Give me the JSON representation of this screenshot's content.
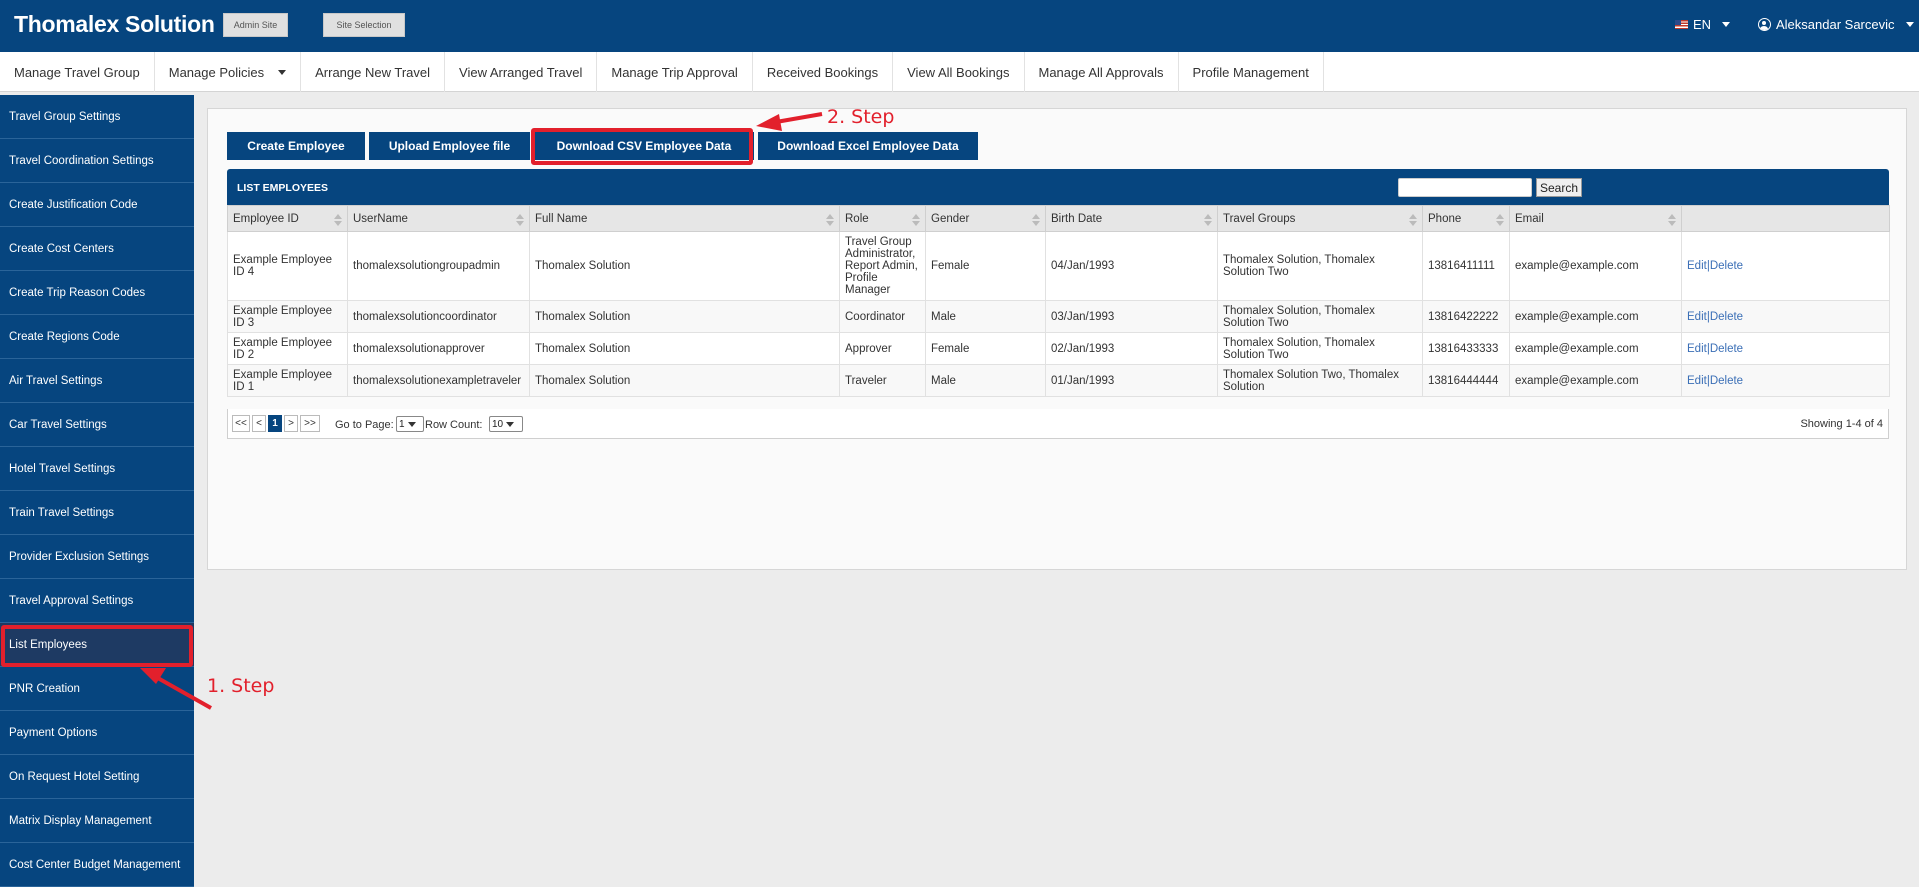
{
  "header": {
    "brand": "Thomalex Solution",
    "admin_site": "Admin Site",
    "site_selection": "Site Selection",
    "language": "EN",
    "user_name": "Aleksandar Sarcevic"
  },
  "topnav": [
    "Manage Travel Group",
    "Manage Policies",
    "Arrange New Travel",
    "View Arranged Travel",
    "Manage Trip Approval",
    "Received Bookings",
    "View All Bookings",
    "Manage All Approvals",
    "Profile Management"
  ],
  "sidebar": [
    "Travel Group Settings",
    "Travel Coordination Settings",
    "Create Justification Code",
    "Create Cost Centers",
    "Create Trip Reason Codes",
    "Create Regions Code",
    "Air Travel Settings",
    "Car Travel Settings",
    "Hotel Travel Settings",
    "Train Travel Settings",
    "Provider Exclusion Settings",
    "Travel Approval Settings",
    "List Employees",
    "PNR Creation",
    "Payment Options",
    "On Request Hotel Setting",
    "Matrix Display Management",
    "Cost Center Budget Management"
  ],
  "actions": {
    "create": "Create Employee",
    "upload": "Upload Employee file",
    "download_csv": "Download CSV Employee Data",
    "download_excel": "Download Excel Employee Data"
  },
  "list": {
    "title": "LIST EMPLOYEES",
    "search_button": "Search",
    "search_value": "",
    "columns": [
      "Employee ID",
      "UserName",
      "Full Name",
      "Role",
      "Gender",
      "Birth Date",
      "Travel Groups",
      "Phone",
      "Email"
    ],
    "rows": [
      {
        "id": "Example Employee ID 4",
        "username": "thomalexsolutiongroupadmin",
        "full_name": "Thomalex Solution",
        "role": "Travel Group Administrator, Report Admin, Profile Manager",
        "gender": "Female",
        "birth": "04/Jan/1993",
        "groups": "Thomalex Solution, Thomalex Solution Two",
        "phone": "13816411111",
        "email": "example@example.com",
        "edit": "Edit",
        "sep": "|",
        "delete": "Delete"
      },
      {
        "id": "Example Employee ID 3",
        "username": "thomalexsolutioncoordinator",
        "full_name": "Thomalex Solution",
        "role": "Coordinator",
        "gender": "Male",
        "birth": "03/Jan/1993",
        "groups": "Thomalex Solution, Thomalex Solution Two",
        "phone": "13816422222",
        "email": "example@example.com",
        "edit": "Edit",
        "sep": "|",
        "delete": "Delete"
      },
      {
        "id": "Example Employee ID 2",
        "username": "thomalexsolutionapprover",
        "full_name": "Thomalex Solution",
        "role": "Approver",
        "gender": "Female",
        "birth": "02/Jan/1993",
        "groups": "Thomalex Solution, Thomalex Solution Two",
        "phone": "13816433333",
        "email": "example@example.com",
        "edit": "Edit",
        "sep": "|",
        "delete": "Delete"
      },
      {
        "id": "Example Employee ID 1",
        "username": "thomalexsolutionexampletraveler",
        "full_name": "Thomalex Solution",
        "role": "Traveler",
        "gender": "Male",
        "birth": "01/Jan/1993",
        "groups": "Thomalex Solution Two, Thomalex Solution",
        "phone": "13816444444",
        "email": "example@example.com",
        "edit": "Edit",
        "sep": "|",
        "delete": "Delete"
      }
    ]
  },
  "pager": {
    "first": "<<",
    "prev": "<",
    "current": "1",
    "next": ">",
    "last": ">>",
    "goto_label": "Go to Page:",
    "goto_value": "1",
    "rowcount_label": "Row Count:",
    "rowcount_value": "10",
    "showing": "Showing 1-4 of 4"
  },
  "annotations": {
    "step1": "1. Step",
    "step2": "2. Step",
    "color": "#e2202c"
  }
}
